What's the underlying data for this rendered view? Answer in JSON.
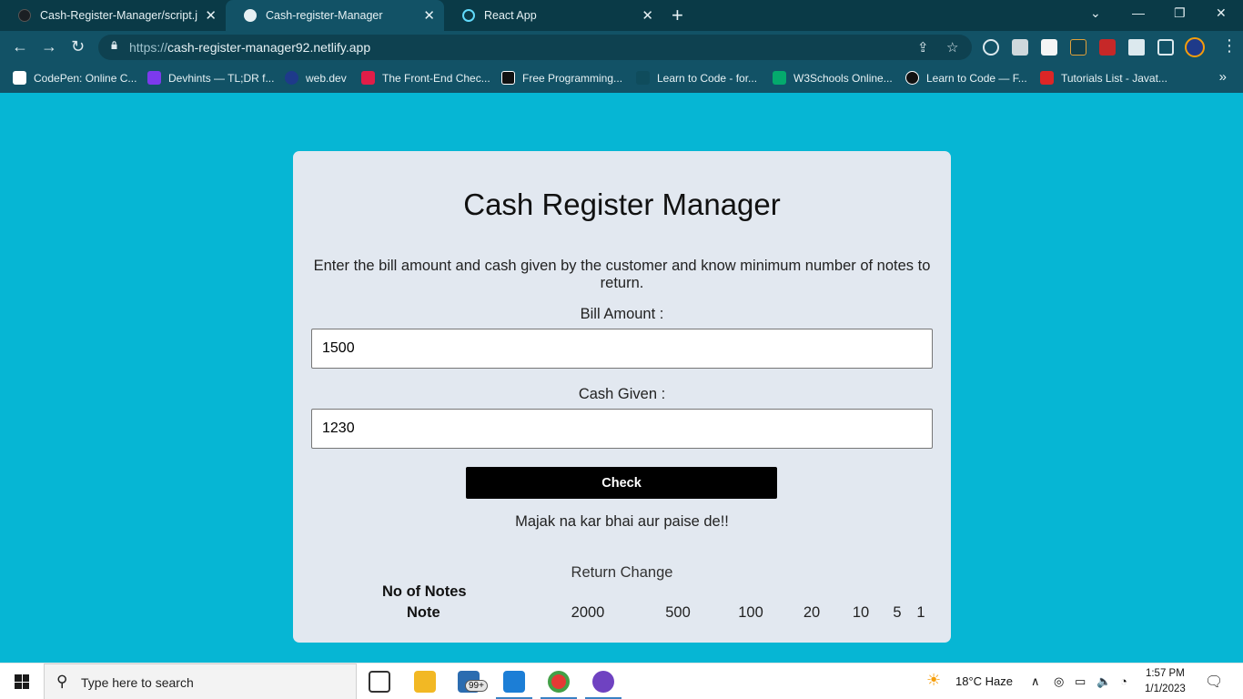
{
  "browser": {
    "tabs": [
      {
        "title": "Cash-Register-Manager/script.js",
        "close": "✕"
      },
      {
        "title": "Cash-register-Manager",
        "close": "✕"
      },
      {
        "title": "React App",
        "close": "✕"
      }
    ],
    "new_tab": "+",
    "window_controls": {
      "chevron": "⌄",
      "minimize": "—",
      "restore": "❐",
      "close": "✕"
    },
    "nav": {
      "back": "←",
      "forward": "→",
      "reload": "↻"
    },
    "url_prefix": "https://",
    "url_host": "cash-register-manager92.netlify.app",
    "bookmarks": [
      {
        "label": "CodePen: Online C...",
        "color": "#ffffff"
      },
      {
        "label": "Devhints — TL;DR f...",
        "color": "#7c3aed"
      },
      {
        "label": "web.dev",
        "color": "#1e3a8a"
      },
      {
        "label": "The Front-End Chec...",
        "color": "#e11d48"
      },
      {
        "label": "Free Programming...",
        "color": "#111111"
      },
      {
        "label": "Learn to Code - for...",
        "color": "#0f4c5c"
      },
      {
        "label": "W3Schools Online...",
        "color": "#04aa6d"
      },
      {
        "label": "Learn to Code — F...",
        "color": "#111111"
      },
      {
        "label": "Tutorials List - Javat...",
        "color": "#dc2626"
      }
    ],
    "bookmarks_more": "»"
  },
  "app": {
    "title": "Cash Register Manager",
    "description": "Enter the bill amount and cash given by the customer and know minimum number of notes to return.",
    "bill_label": "Bill Amount :",
    "bill_value": "1500",
    "cash_label": "Cash Given :",
    "cash_value": "1230",
    "check_label": "Check",
    "message": "Majak na kar bhai aur paise de!!",
    "return_caption": "Return Change",
    "table": {
      "row_no_of_notes": "No of Notes",
      "row_note": "Note",
      "notes": [
        "2000",
        "500",
        "100",
        "20",
        "10",
        "5",
        "1"
      ]
    }
  },
  "taskbar": {
    "search_placeholder": "Type here to search",
    "mail_badge": "99+",
    "weather": "18°C  Haze",
    "time": "1:57 PM",
    "date": "1/1/2023"
  },
  "colors": {
    "page_bg": "#06b6d4",
    "card_bg": "#e2e8f0",
    "button_bg": "#000000",
    "chrome_tab_bar": "#0a3a47",
    "chrome_toolbar": "#125266"
  }
}
